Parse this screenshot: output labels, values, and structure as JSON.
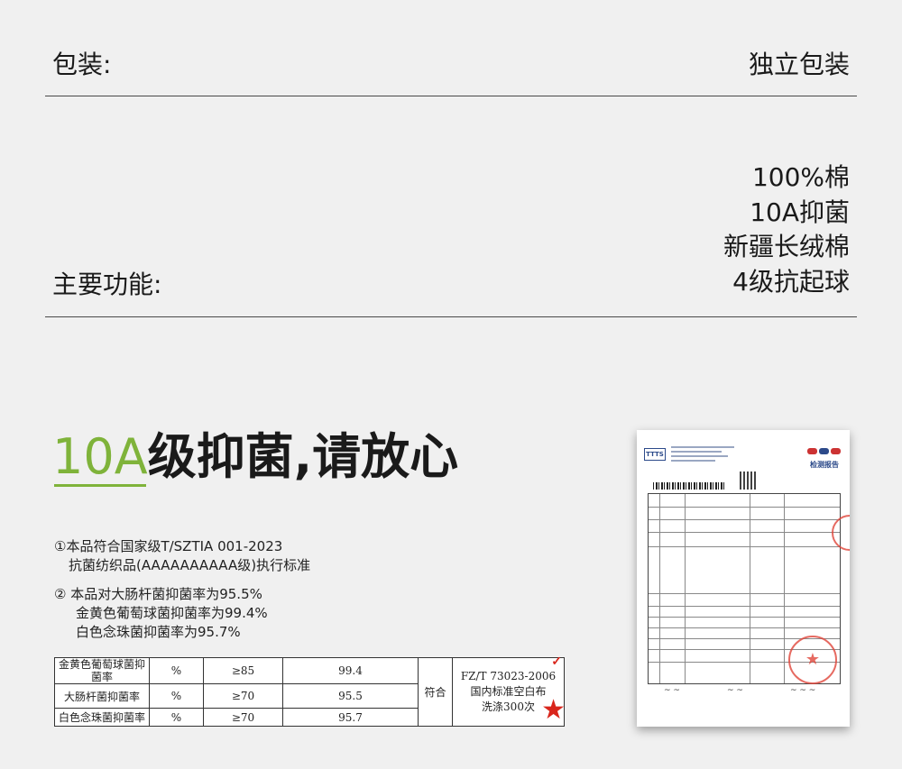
{
  "packaging": {
    "label": "包装:",
    "value": "独立包装"
  },
  "features": {
    "label": "主要功能:",
    "items": [
      "100%棉",
      "10A抑菌",
      "新疆长绒棉",
      "4级抗起球"
    ]
  },
  "headline": {
    "accent": "10A",
    "rest": "级抑菌,请放心"
  },
  "notes": [
    "①本品符合国家级T/SZTIA 001-2023",
    "  抗菌纺织品(AAAAAAAAAA级)执行标准",
    "② 本品对大肠杆菌抑菌率为95.5%",
    "  金黄色葡萄球菌抑菌率为99.4%",
    "  白色念珠菌抑菌率为95.7%"
  ],
  "table": {
    "rows": [
      {
        "name": "金黄色葡萄球菌抑菌率",
        "unit": "%",
        "req": "≥85",
        "result": "99.4"
      },
      {
        "name": "大肠杆菌抑菌率",
        "unit": "%",
        "req": "≥70",
        "result": "95.5"
      },
      {
        "name": "白色念珠菌抑菌率",
        "unit": "%",
        "req": "≥70",
        "result": "95.7"
      }
    ],
    "verdict": "符合",
    "standard": [
      "FZ/T 73023-2006",
      "国内标准空白布",
      "洗涤300次"
    ]
  },
  "certificate": {
    "logo": "TTTS",
    "title": "检测报告"
  },
  "colors": {
    "accent": "#7fb33a",
    "background": "#f0f0f0",
    "stamp": "#d9261c"
  }
}
